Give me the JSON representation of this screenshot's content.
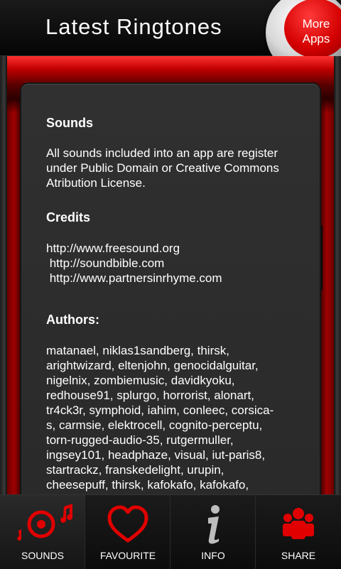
{
  "header": {
    "title": "Latest Ringtones",
    "more_apps": [
      "More",
      "Apps"
    ]
  },
  "content": {
    "sounds_heading": "Sounds",
    "sounds_text": [
      "All sounds included into an app are register",
      "under Public Domain or Creative Commons",
      "Atribution License."
    ],
    "credits_heading": "Credits",
    "credits_links": [
      "http://www.freesound.org",
      " http://soundbible.com",
      " http://www.partnersinrhyme.com"
    ],
    "authors_heading": "Authors:",
    "authors_lines": [
      "matanael, niklas1sandberg, thirsk,",
      "arightwizard, eltenjohn, genocidalguitar,",
      "nigelnix, zombiemusic, davidkyoku,",
      "redhouse91, splurgo, horrorist, alonart,",
      "tr4ck3r, symphoid, iahim, conleec, corsica-",
      "s, carmsie, elektrocell, cognito-perceptu,",
      "torn-rugged-audio-35, rutgermuller,",
      "ingsey101, headphaze, visual, iut-paris8,",
      "startrackz, franskedelight, urupin,",
      "cheesepuff, thirsk, kafokafo, kafokafo,"
    ]
  },
  "nav": {
    "items": [
      {
        "label": "SOUNDS",
        "icon": "music-disc-icon"
      },
      {
        "label": "FAVOURITE",
        "icon": "heart-icon"
      },
      {
        "label": "INFO",
        "icon": "info-icon"
      },
      {
        "label": "SHARE",
        "icon": "people-icon"
      }
    ]
  },
  "colors": {
    "accent": "#e00000",
    "background": "#2c2c2c",
    "text": "#ffffff"
  }
}
